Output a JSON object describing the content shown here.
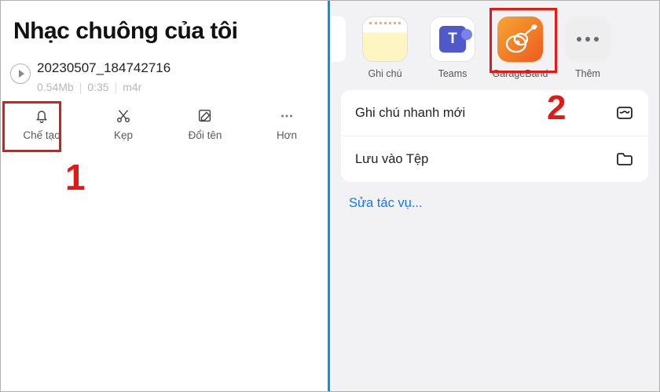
{
  "left": {
    "title": "Nhạc chuông của tôi",
    "file": {
      "name": "20230507_184742716",
      "size": "0.54Mb",
      "duration": "0:35",
      "ext": "m4r"
    },
    "actions": {
      "create": "Chế tạo",
      "clip": "Kẹp",
      "rename": "Đổi tên",
      "more": "Hơn"
    }
  },
  "right": {
    "apps": {
      "notes": "Ghi chú",
      "teams": "Teams",
      "garageband": "GarageBand",
      "more": "Thêm"
    },
    "actions": {
      "quicknote": "Ghi chú nhanh mới",
      "savefiles": "Lưu vào Tệp",
      "editactions": "Sửa tác vụ..."
    }
  },
  "callouts": {
    "one": "1",
    "two": "2"
  }
}
